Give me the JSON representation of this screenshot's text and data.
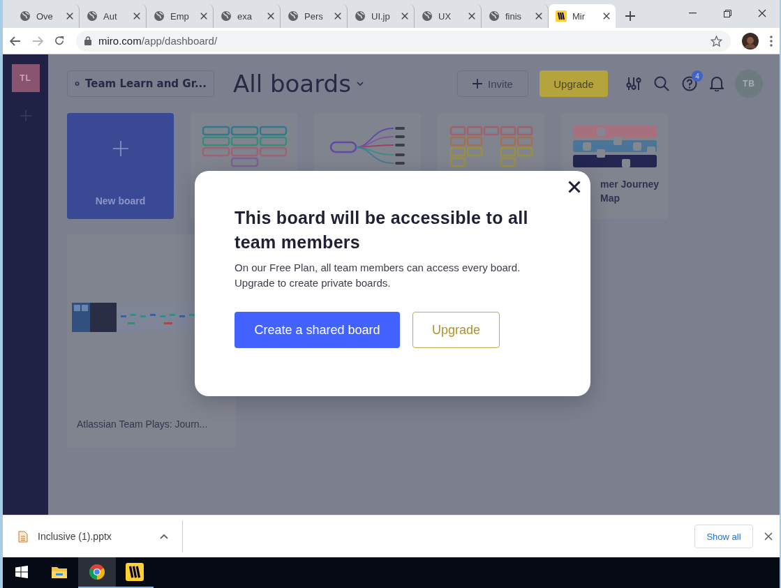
{
  "browser": {
    "tabs": [
      {
        "title": "Ove",
        "kind": "globe",
        "selected": false
      },
      {
        "title": "Aut",
        "kind": "globe",
        "selected": false
      },
      {
        "title": "Emp",
        "kind": "globe",
        "selected": false
      },
      {
        "title": "exa",
        "kind": "globe",
        "selected": false
      },
      {
        "title": "Pers",
        "kind": "globe",
        "selected": false
      },
      {
        "title": "UI.jp",
        "kind": "globe",
        "selected": false
      },
      {
        "title": "UX",
        "kind": "globe",
        "selected": false
      },
      {
        "title": "finis",
        "kind": "globe",
        "selected": false
      },
      {
        "title": "Mir",
        "kind": "miro",
        "selected": true
      }
    ],
    "url_host": "miro.com",
    "url_path": "/app/dashboard/"
  },
  "sidebar": {
    "team_initials": "TL"
  },
  "header": {
    "team": "Team Learn and Gr...",
    "title": "All boards",
    "invite": "Invite",
    "upgrade": "Upgrade",
    "help_badge": "4",
    "user_initials": "TB"
  },
  "boards": [
    {
      "kind": "new",
      "title": "New board"
    },
    {
      "kind": "grid"
    },
    {
      "kind": "mindmap"
    },
    {
      "kind": "kanban"
    },
    {
      "kind": "journey",
      "title": "mer Journey Map"
    },
    {
      "kind": "wide",
      "title": "Atlassian Team Plays: Journ..."
    }
  ],
  "dialog": {
    "title": "This board will be accessible to all team members",
    "body": "On our Free Plan, all team members can access every board. Upgrade to create private boards.",
    "primary": "Create a shared board",
    "secondary": "Upgrade"
  },
  "downloads": {
    "file": "Inclusive (1).pptx",
    "show_all": "Show all"
  },
  "taskbar": {
    "apps": [
      {
        "kind": "start",
        "selected": false,
        "running": false
      },
      {
        "kind": "files",
        "selected": false,
        "running": false
      },
      {
        "kind": "chrome",
        "selected": true,
        "running": true
      },
      {
        "kind": "miro",
        "selected": false,
        "running": true
      }
    ]
  }
}
